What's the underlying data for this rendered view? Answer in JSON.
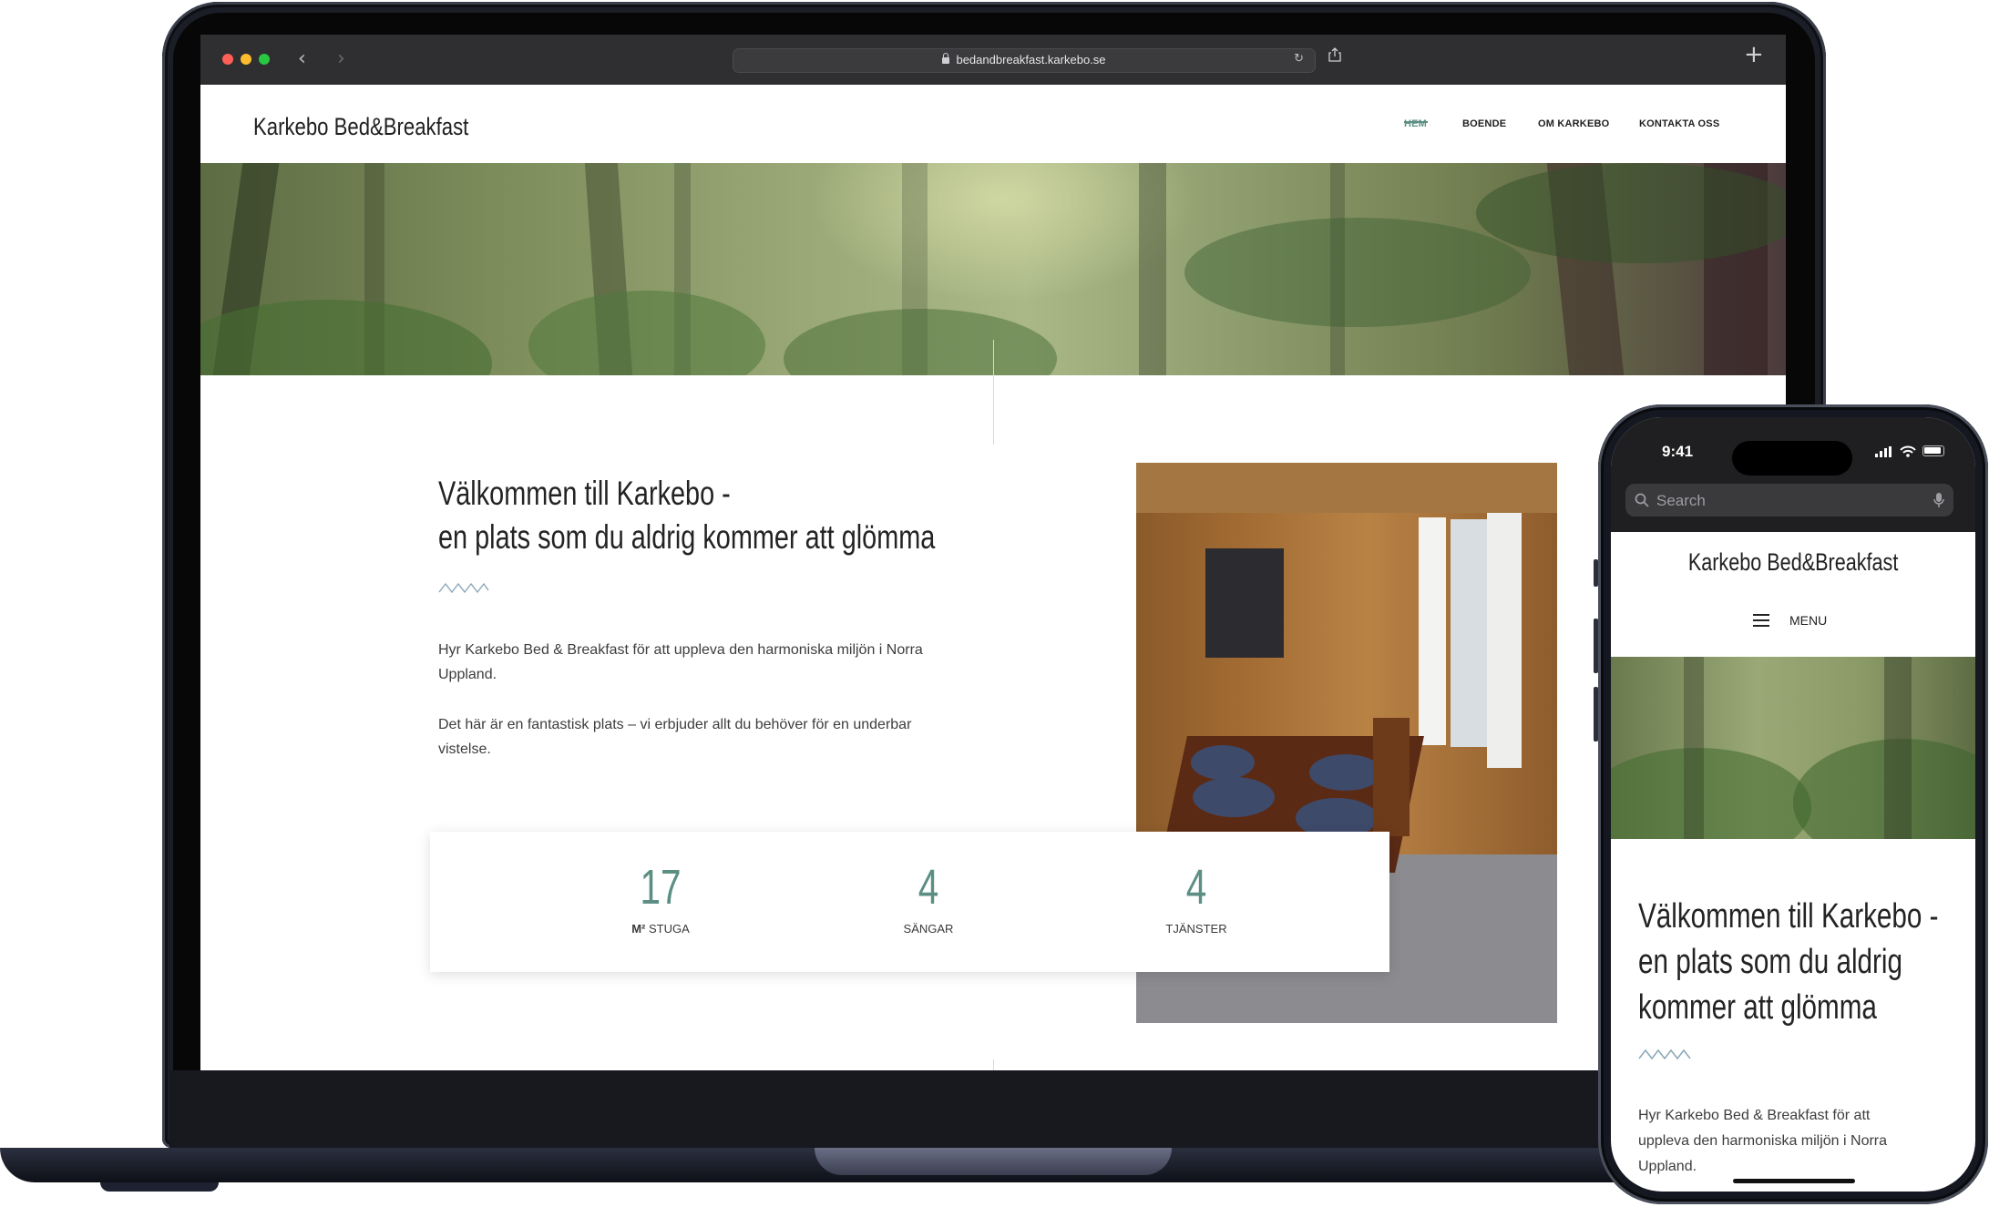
{
  "browser": {
    "url": "bedandbreakfast.karkebo.se"
  },
  "site": {
    "logo": "Karkebo Bed&Breakfast",
    "nav": [
      "HEM",
      "BOENDE",
      "OM KARKEBO",
      "KONTAKTA OSS"
    ],
    "active_nav": "HEM",
    "accent_color": "#5c8f84"
  },
  "welcome": {
    "heading_line1": "Välkommen till Karkebo -",
    "heading_line2": "en plats som du aldrig kommer att glömma",
    "para1": "Hyr Karkebo Bed & Breakfast för att uppleva den harmoniska miljön i Norra Uppland.",
    "para2": "Det här är en fantastisk plats – vi erbjuder allt du behöver för en underbar vistelse."
  },
  "stats": [
    {
      "value": "17",
      "unit": "M²",
      "label": "STUGA"
    },
    {
      "value": "4",
      "unit": "",
      "label": "SÄNGAR"
    },
    {
      "value": "4",
      "unit": "",
      "label": "TJÄNSTER"
    }
  ],
  "phone": {
    "time": "9:41",
    "search_placeholder": "Search",
    "logo": "Karkebo Bed&Breakfast",
    "menu_label": "MENU",
    "heading_line1": "Välkommen till Karkebo -",
    "heading_line2": "en plats som du aldrig",
    "heading_line3": "kommer att glömma",
    "para_line1": "Hyr Karkebo Bed & Breakfast för att",
    "para_line2": "uppleva den harmoniska miljön i Norra",
    "para_line3": "Uppland."
  }
}
